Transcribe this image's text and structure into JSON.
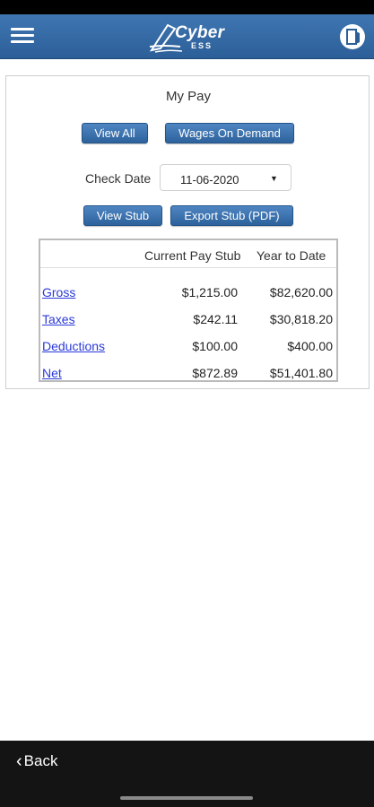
{
  "app": {
    "logo_text": "Cyber",
    "logo_sub": "ESS",
    "brand_color": "#3a6fa9"
  },
  "header": {
    "menu_icon": "hamburger-menu-icon",
    "logout_icon": "logout-door-icon"
  },
  "page": {
    "title": "My Pay",
    "buttons": {
      "view_all": "View All",
      "wages_on_demand": "Wages On Demand",
      "view_stub": "View Stub",
      "export_stub": "Export Stub (PDF)"
    },
    "check_date": {
      "label": "Check Date",
      "value": "11-06-2020"
    }
  },
  "table": {
    "columns": [
      "",
      "Current Pay Stub",
      "Year to Date"
    ],
    "rows": [
      {
        "label": "Gross",
        "current": "$1,215.00",
        "ytd": "$82,620.00"
      },
      {
        "label": "Taxes",
        "current": "$242.11",
        "ytd": "$30,818.20"
      },
      {
        "label": "Deductions",
        "current": "$100.00",
        "ytd": "$400.00"
      },
      {
        "label": "Net",
        "current": "$872.89",
        "ytd": "$51,401.80"
      }
    ]
  },
  "footer": {
    "back_label": "Back"
  }
}
